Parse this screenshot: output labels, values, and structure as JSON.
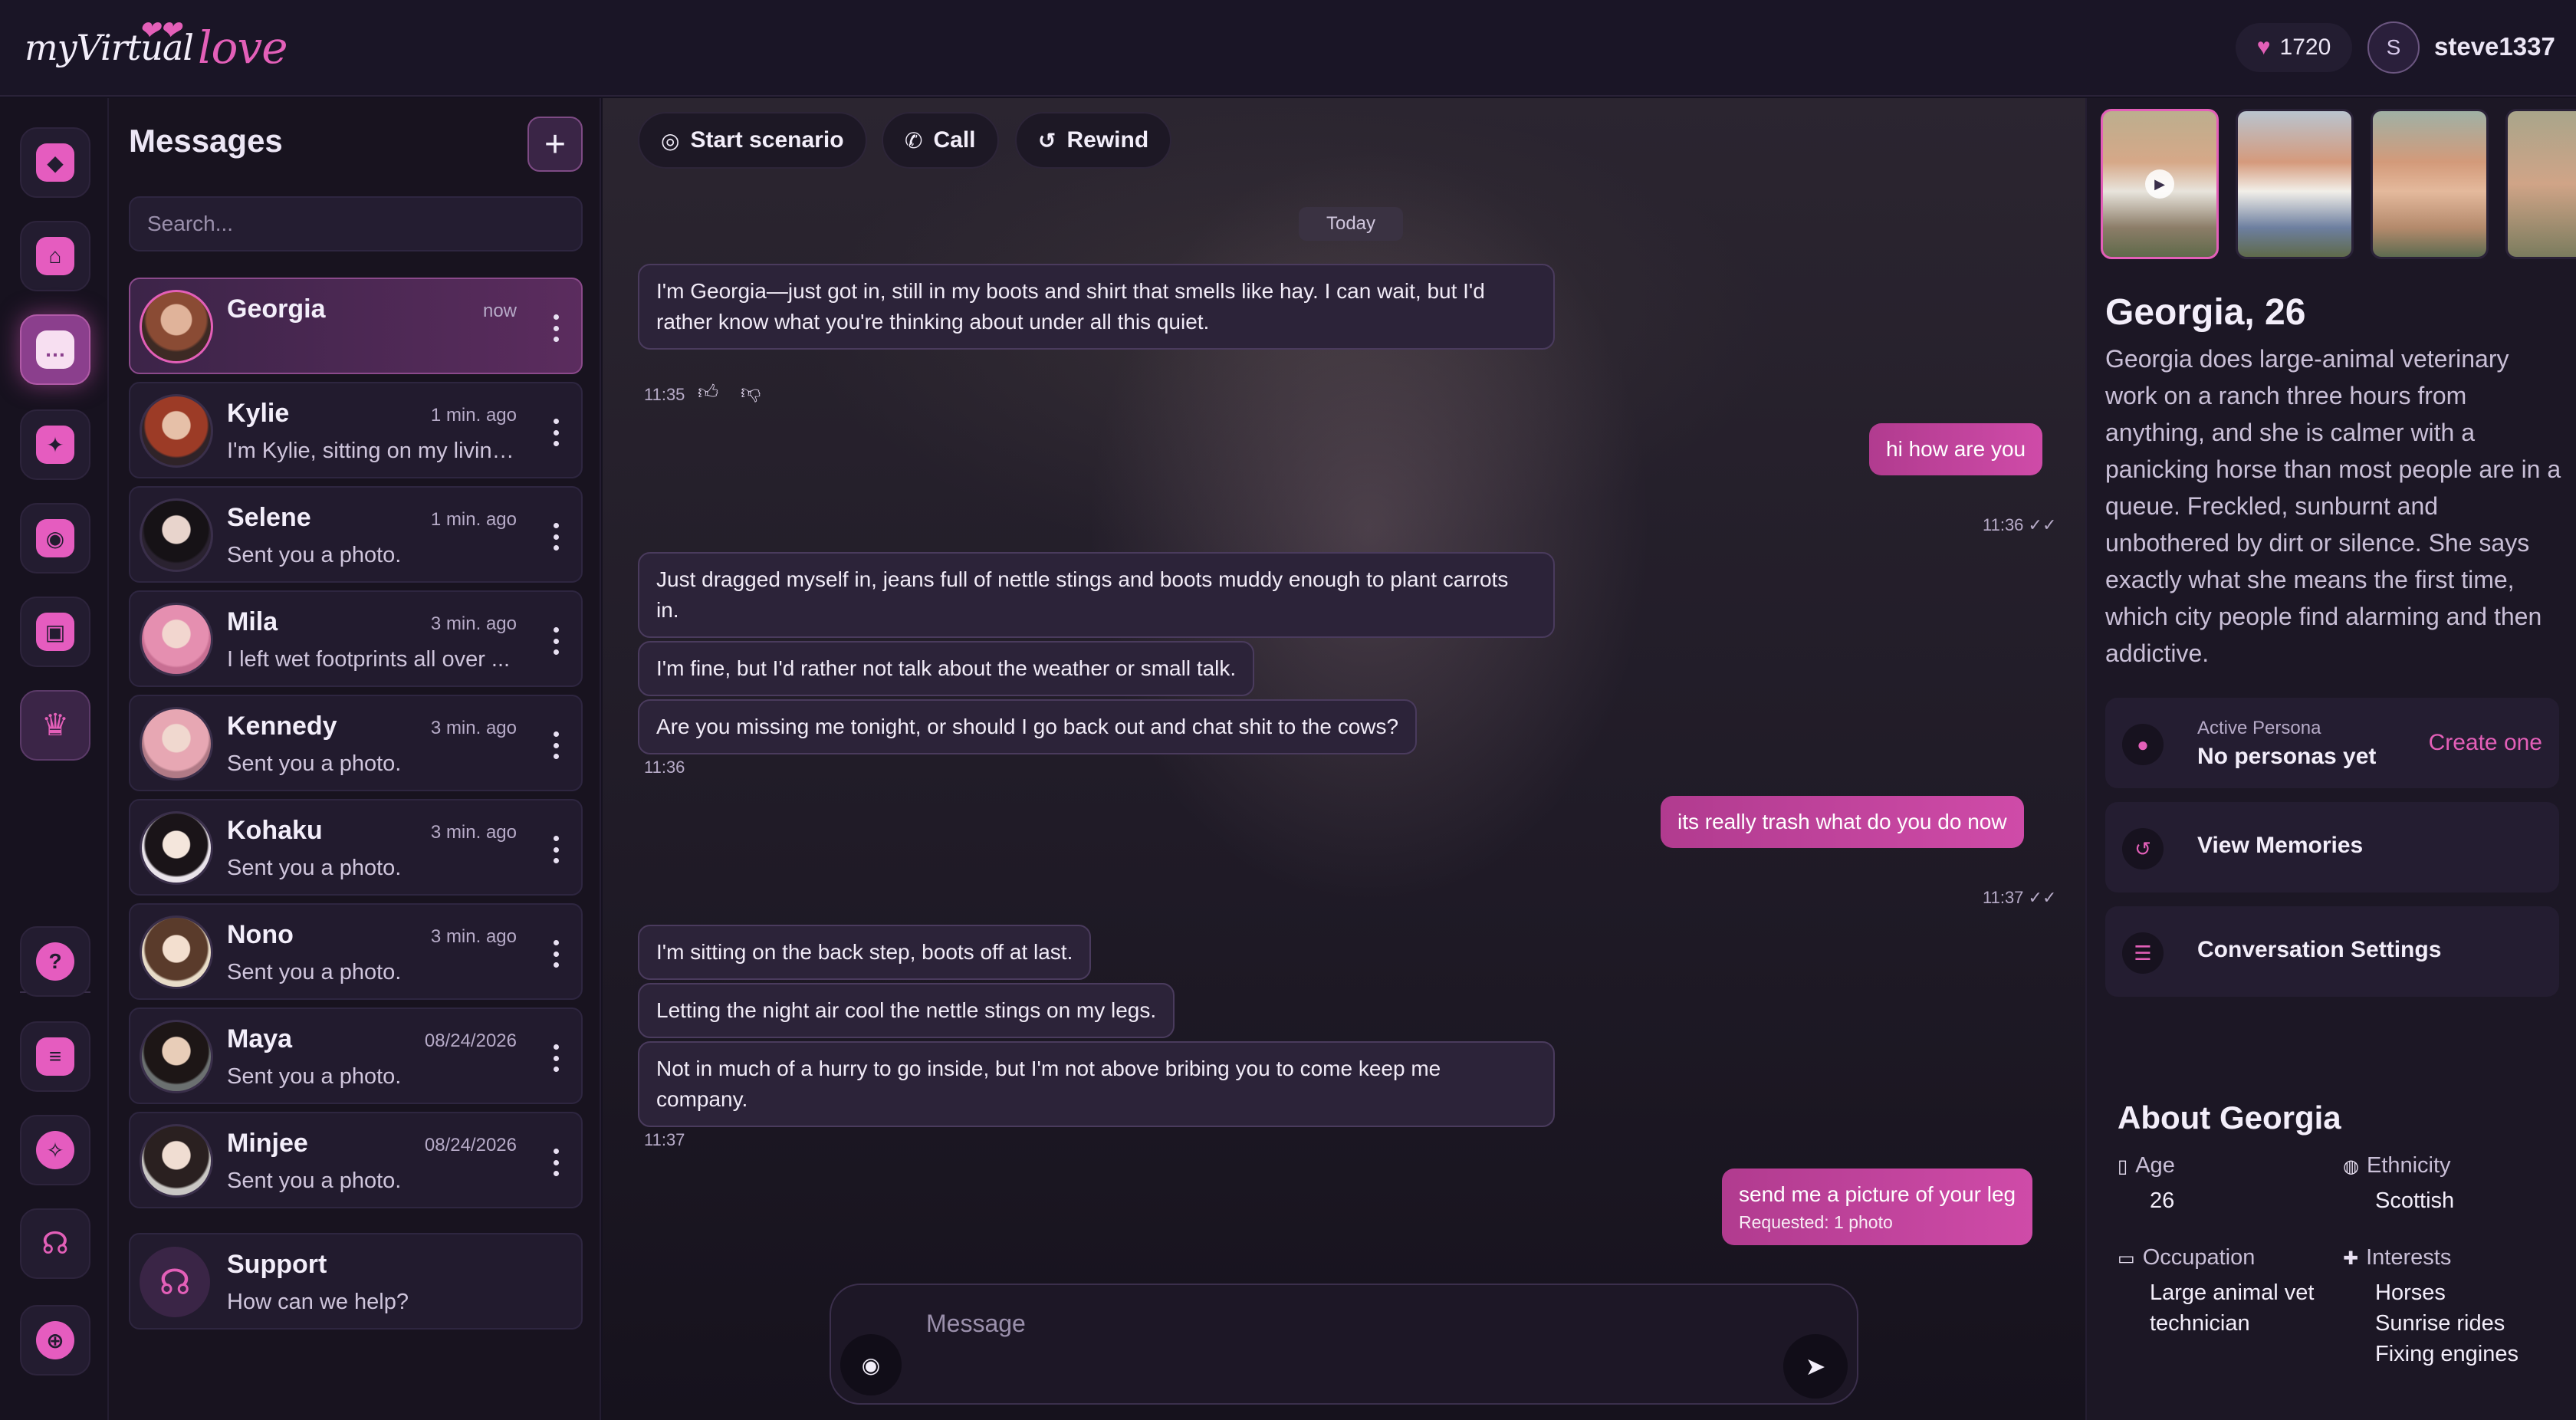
{
  "header": {
    "logo_text_1": "myVirtual",
    "logo_text_2": "love",
    "coins": "1720",
    "user_initial": "S",
    "username": "steve1337"
  },
  "rail": {
    "icons": [
      "shield-user-icon",
      "home-icon",
      "chat-icon",
      "magic-wand-icon",
      "camera-icon",
      "gallery-icon",
      "crown-icon",
      "help-icon",
      "document-icon",
      "lightbulb-icon",
      "headphones-icon",
      "globe-icon"
    ]
  },
  "messages": {
    "title": "Messages",
    "new_button": "+",
    "search_placeholder": "Search...",
    "conversations": [
      {
        "name": "Georgia",
        "time": "now",
        "preview": ""
      },
      {
        "name": "Kylie",
        "time": "1 min. ago",
        "preview": "I'm Kylie, sitting on my living..."
      },
      {
        "name": "Selene",
        "time": "1 min. ago",
        "preview": "Sent you a photo."
      },
      {
        "name": "Mila",
        "time": "3 min. ago",
        "preview": "I left wet footprints all over ..."
      },
      {
        "name": "Kennedy",
        "time": "3 min. ago",
        "preview": "Sent you a photo."
      },
      {
        "name": "Kohaku",
        "time": "3 min. ago",
        "preview": "Sent you a photo."
      },
      {
        "name": "Nono",
        "time": "3 min. ago",
        "preview": "Sent you a photo."
      },
      {
        "name": "Maya",
        "time": "08/24/2026",
        "preview": "Sent you a photo."
      },
      {
        "name": "Minjee",
        "time": "08/24/2026",
        "preview": "Sent you a photo."
      }
    ],
    "support": {
      "name": "Support",
      "preview": "How can we help?"
    }
  },
  "chat": {
    "actions": {
      "scenario": "Start scenario",
      "call": "Call",
      "rewind": "Rewind"
    },
    "date_label": "Today",
    "messages": [
      {
        "from": "her",
        "text": "I'm Georgia—just got in, still in my boots and shirt that smells like hay. I can wait, but I'd rather know what you're thinking about under all this quiet."
      },
      {
        "from": "meta",
        "text": "11:35"
      },
      {
        "from": "me",
        "text": "hi how are you",
        "time": "11:36"
      },
      {
        "from": "her",
        "text": "Just dragged myself in, jeans full of nettle stings and boots muddy enough to plant carrots in."
      },
      {
        "from": "her",
        "text": "I'm fine, but I'd rather not talk about the weather or small talk."
      },
      {
        "from": "her",
        "text": "Are you missing me tonight, or should I go back out and chat shit to the cows?"
      },
      {
        "from": "meta",
        "text": "11:36"
      },
      {
        "from": "me",
        "text": "its really trash what do you do now",
        "time": "11:37"
      },
      {
        "from": "her",
        "text": "I'm sitting on the back step, boots off at last."
      },
      {
        "from": "her",
        "text": "Letting the night air cool the nettle stings on my legs."
      },
      {
        "from": "her",
        "text": "Not in much of a hurry to go inside, but I'm not above bribing you to come keep me company."
      },
      {
        "from": "meta",
        "text": "11:37"
      },
      {
        "from": "me",
        "text": "send me a picture of your leg",
        "sub": "Requested: 1 photo"
      }
    ],
    "composer_placeholder": "Message"
  },
  "profile": {
    "name_age": "Georgia, 26",
    "bio": "Georgia does large-animal veterinary work on a ranch three hours from anything, and she is calmer with a panicking horse than most people are in a queue. Freckled, sunburnt and unbothered by dirt or silence. She says exactly what she means the first time, which city people find alarming and then addictive.",
    "persona_label": "Active Persona",
    "persona_value": "No personas yet",
    "persona_link": "Create one",
    "view_memories": "View Memories",
    "conversation_settings": "Conversation Settings",
    "about_title": "About Georgia",
    "attributes": {
      "age_label": "Age",
      "age_value": "26",
      "ethnicity_label": "Ethnicity",
      "ethnicity_value": "Scottish",
      "occupation_label": "Occupation",
      "occupation_value_1": "Large animal vet",
      "occupation_value_2": "technician",
      "interests_label": "Interests",
      "interests_1": "Horses",
      "interests_2": "Sunrise rides",
      "interests_3": "Fixing engines"
    }
  },
  "colors": {
    "accent": "#e35fb8",
    "background": "#15111f",
    "panel": "#221b2e"
  }
}
